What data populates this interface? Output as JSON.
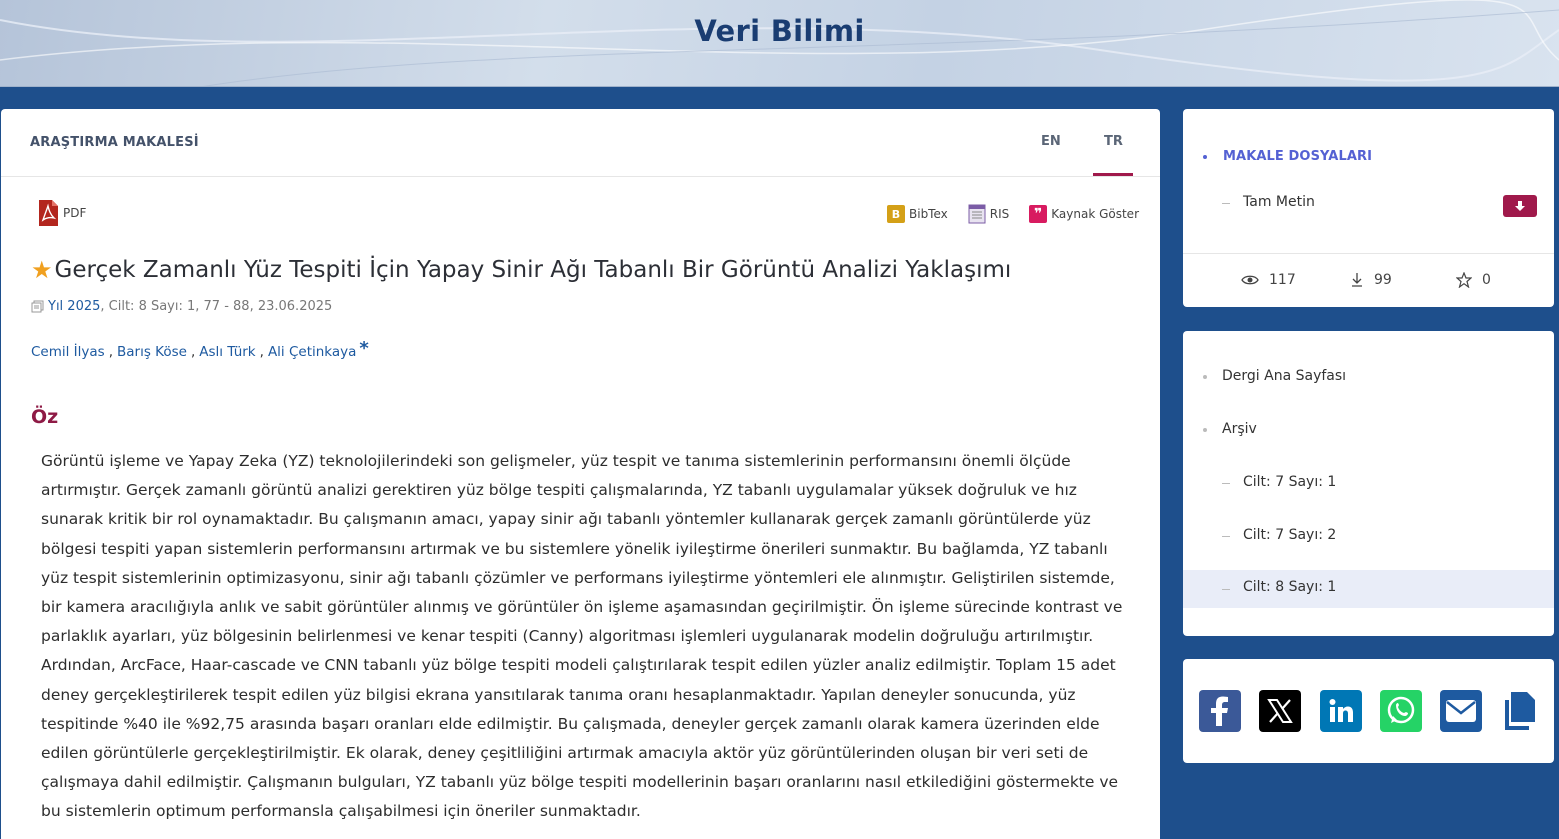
{
  "banner": {
    "title": "Veri Bilimi"
  },
  "article": {
    "type_label": "ARAŞTIRMA MAKALESİ",
    "lang_tabs": [
      "EN",
      "TR"
    ],
    "active_lang": "TR",
    "pdf_label": "PDF",
    "tools": {
      "bibtex": "BibTex",
      "ris": "RIS",
      "cite": "Kaynak Göster"
    },
    "title": "Gerçek Zamanlı Yüz Tespiti İçin Yapay Sinir Ağı Tabanlı Bir Görüntü Analizi Yaklaşımı",
    "meta": {
      "year": "Yıl 2025",
      "rest": ", Cilt: 8 Sayı: 1, 77 - 88, 23.06.2025"
    },
    "authors": [
      "Cemil İlyas",
      "Barış Köse",
      "Aslı Türk",
      "Ali Çetinkaya"
    ],
    "author_separator": " ,",
    "corresponding_mark": "*",
    "abstract_heading": "Öz",
    "abstract": "Görüntü işleme ve Yapay Zeka (YZ) teknolojilerindeki son gelişmeler, yüz tespit ve tanıma sistemlerinin performansını önemli ölçüde artırmıştır. Gerçek zamanlı görüntü analizi gerektiren yüz bölge tespiti çalışmalarında, YZ tabanlı uygulamalar yüksek doğruluk ve hız sunarak kritik bir rol oynamaktadır. Bu çalışmanın amacı, yapay sinir ağı tabanlı yöntemler kullanarak gerçek zamanlı görüntülerde yüz bölgesi tespiti yapan sistemlerin performansını artırmak ve bu sistemlere yönelik iyileştirme önerileri sunmaktır. Bu bağlamda, YZ tabanlı yüz tespit sistemlerinin optimizasyonu, sinir ağı tabanlı çözümler ve performans iyileştirme yöntemleri ele alınmıştır. Geliştirilen sistemde, bir kamera aracılığıyla anlık ve sabit görüntüler alınmış ve görüntüler ön işleme aşamasından geçirilmiştir. Ön işleme sürecinde kontrast ve parlaklık ayarları, yüz bölgesinin belirlenmesi ve kenar tespiti (Canny) algoritması işlemleri uygulanarak modelin doğruluğu artırılmıştır. Ardından, ArcFace, Haar-cascade ve CNN tabanlı yüz bölge tespiti modeli çalıştırılarak tespit edilen yüzler analiz edilmiştir. Toplam 15 adet deney gerçekleştirilerek tespit edilen yüz bilgisi ekrana yansıtılarak tanıma oranı hesaplanmaktadır. Yapılan deneyler sonucunda, yüz tespitinde %40 ile %92,75 arasında başarı oranları elde edilmiştir. Bu çalışmada, deneyler gerçek zamanlı olarak kamera üzerinden elde edilen görüntülerle gerçekleştirilmiştir. Ek olarak, deney çeşitliliğini artırmak amacıyla aktör yüz görüntülerinden oluşan bir veri seti de çalışmaya dahil edilmiştir. Çalışmanın bulguları, YZ tabanlı yüz bölge tespiti modellerinin başarı oranlarını nasıl etkilediğini göstermekte ve bu sistemlerin optimum performansla çalışabilmesi için öneriler sunmaktadır."
  },
  "sidebar": {
    "files_title": "MAKALE DOSYALARI",
    "fulltext_label": "Tam Metin",
    "stats": {
      "views": "117",
      "downloads": "99",
      "favorites": "0"
    },
    "nav": {
      "home": "Dergi Ana Sayfası",
      "archive": "Arşiv",
      "issues": [
        "Cilt: 7 Sayı: 1",
        "Cilt: 7 Sayı: 2",
        "Cilt: 8 Sayı: 1"
      ],
      "active_issue": "Cilt: 8 Sayı: 1"
    }
  },
  "share": [
    "facebook-icon",
    "x-icon",
    "linkedin-icon",
    "whatsapp-icon",
    "email-icon",
    "copy-icon"
  ],
  "colors": {
    "page_bg": "#1e4f8c",
    "accent": "#a0194b",
    "link": "#1e5aa0",
    "files_title": "#5461d3",
    "facebook": "#3b5998",
    "linkedin": "#0077b5",
    "whatsapp": "#25d366",
    "email": "#1e5aa0"
  }
}
